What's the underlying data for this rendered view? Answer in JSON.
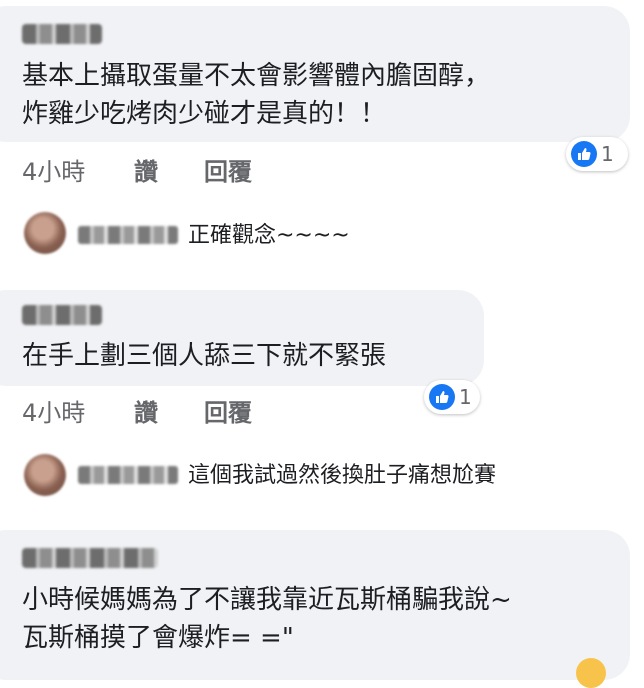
{
  "comments": [
    {
      "lines": [
        "基本上攝取蛋量不太會影響體內膽固醇，",
        "炸雞少吃烤肉少碰才是真的！！"
      ],
      "time": "4小時",
      "like_label": "讚",
      "reply_label": "回覆",
      "reaction_count": "1"
    },
    {
      "lines": [
        "在手上劃三個人舔三下就不緊張"
      ],
      "time": "4小時",
      "like_label": "讚",
      "reply_label": "回覆",
      "reaction_count": "1"
    },
    {
      "lines": [
        "小時候媽媽為了不讓我靠近瓦斯桶騙我說~",
        "瓦斯桶摸了會爆炸= =\""
      ]
    }
  ],
  "replies": [
    {
      "text": "正確觀念~~~~"
    },
    {
      "text": "這個我試過然後換肚子痛想尬賽"
    }
  ],
  "icons": {
    "reaction": "thumbs-up-icon",
    "accent": "#1877f2"
  }
}
